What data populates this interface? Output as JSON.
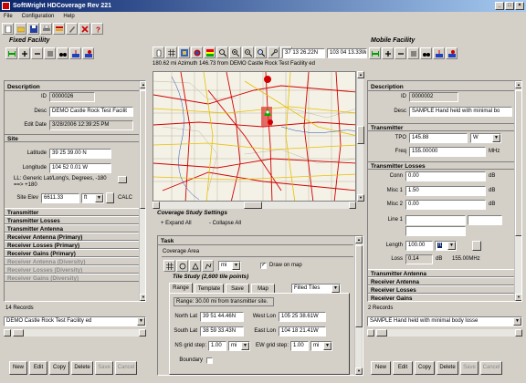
{
  "window": {
    "title": "SoftWright HDCoverage Rev 221"
  },
  "menu": [
    "File",
    "Configuration",
    "Help"
  ],
  "fixed": {
    "group_title": "Fixed Facility",
    "description": {
      "header": "Description",
      "id_label": "ID",
      "id": "0000026",
      "desc_label": "Desc",
      "desc": "DEMO Castle Rock Test Facilit",
      "edit_label": "Edit Date",
      "edit_date": "3/28/2006 12:39:25 PM"
    },
    "site": {
      "header": "Site",
      "lat_label": "Latitude",
      "lat": "39 25 39.00 N",
      "lon_label": "Longitude",
      "lon": "104 52 0.01 W",
      "ll_note": "LL: Generic Lat/Long's, Degrees, -180 ==> +180",
      "elev_label": "Site Elev",
      "elev": "6611.33",
      "elev_unit": "ft",
      "calc": "CALC"
    },
    "sections": [
      "Transmitter",
      "Transmitter Losses",
      "Transmitter Antenna",
      "Receiver Antenna (Primary)",
      "Receiver Losses (Primary)",
      "Receiver Gains (Primary)",
      "Receiver Antenna (Diversity)",
      "Receiver Losses (Diversity)",
      "Receiver Gains (Diversity)"
    ],
    "records": "14 Records",
    "selector": "DEMO Castle Rock Test Facility ed",
    "buttons": [
      "New",
      "Edit",
      "Copy",
      "Delete",
      "Save",
      "Cancel"
    ]
  },
  "mobile": {
    "group_title": "Mobile Facility",
    "description": {
      "header": "Description",
      "id_label": "ID",
      "id": "0000002",
      "desc_label": "Desc",
      "desc": "SAMPLE Hand held with minimal bo"
    },
    "transmitter": {
      "header": "Transmitter",
      "tpo_label": "TPO",
      "tpo": "145.88",
      "tpo_unit": "W",
      "freq_label": "Freq",
      "freq": "155.00000",
      "freq_unit": "MHz"
    },
    "losses": {
      "header": "Transmitter Losses",
      "conn_label": "Conn",
      "conn": "0.00",
      "misc1_label": "Misc 1",
      "misc1": "1.50",
      "misc2_label": "Misc 2",
      "misc2": "0.00",
      "line1_label": "Line 1",
      "length_label": "Length",
      "length": "100.00",
      "length_unit": "ft",
      "loss_label": "Loss",
      "loss": "0.14",
      "loss_unit": "dB",
      "loss_freq": "155.00MHz",
      "db": "dB"
    },
    "sections": [
      "Transmitter Antenna",
      "Receiver Antenna",
      "Receiver Losses",
      "Receiver Gains"
    ],
    "records": "2 Records",
    "selector": "SAMPLE Hand held with minimal body losse",
    "buttons": [
      "New",
      "Edit",
      "Copy",
      "Delete",
      "Save",
      "Cancel"
    ]
  },
  "map": {
    "coord1": "37 13 26.22N",
    "coord2": "103 04 13.33W",
    "status": "180.62 mi Azimuth 146.73 from DEMO Castle Rock Test Facility ed"
  },
  "study": {
    "title": "Coverage Study Settings",
    "expand": "+ Expand All",
    "collapse": "- Collapse All",
    "task": "Task",
    "coverage_area": "Coverage Area",
    "unit": "mi",
    "draw_on_map": "Draw on map",
    "tile_title": "Tile Study (2,600 tile points)",
    "tabs": [
      "Range",
      "Template",
      "Save",
      "Map"
    ],
    "tile_mode": "Filled Tiles",
    "range_text": "Range: 30.00 mi from transmitter site.",
    "north_lat_label": "North Lat",
    "north_lat": "39 51 44.46N",
    "south_lat_label": "South Lat",
    "south_lat": "38 59 33.43N",
    "west_lon_label": "West Lon",
    "west_lon": "105 25 38.61W",
    "east_lon_label": "East Lon",
    "east_lon": "104 18 21.41W",
    "ns_label": "NS grid step:",
    "ns": "1.00",
    "ns_unit": "mi",
    "ew_label": "EW grid step:",
    "ew": "1.00",
    "ew_unit": "mi",
    "boundary_label": "Boundary"
  }
}
